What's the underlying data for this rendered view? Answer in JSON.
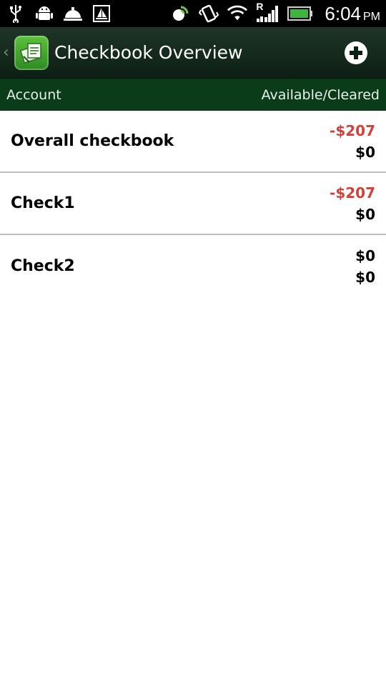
{
  "status_bar": {
    "left_icons": [
      "usb-icon",
      "android-debug-icon",
      "service-bell-icon",
      "sailboat-icon"
    ],
    "right_icons": [
      "sync-icon",
      "vibrate-icon",
      "wifi-icon",
      "signal-roaming-icon",
      "battery-icon"
    ],
    "roaming_label": "R",
    "time": "6:04",
    "ampm": "PM"
  },
  "action_bar": {
    "title": "Checkbook Overview",
    "app_icon": "checkbook-app-icon",
    "action_icon": "add-circle-icon"
  },
  "columns": {
    "left": "Account",
    "right": "Available/Cleared"
  },
  "accounts": [
    {
      "name": "Overall checkbook",
      "available": "-$207",
      "cleared": "$0"
    },
    {
      "name": "Check1",
      "available": "-$207",
      "cleared": "$0"
    },
    {
      "name": "Check2",
      "available": "$0",
      "cleared": "$0"
    }
  ],
  "colors": {
    "negative": "#d0413b",
    "header_bg": "#0b3c1a",
    "action_bar_bg": "#1f3528"
  }
}
